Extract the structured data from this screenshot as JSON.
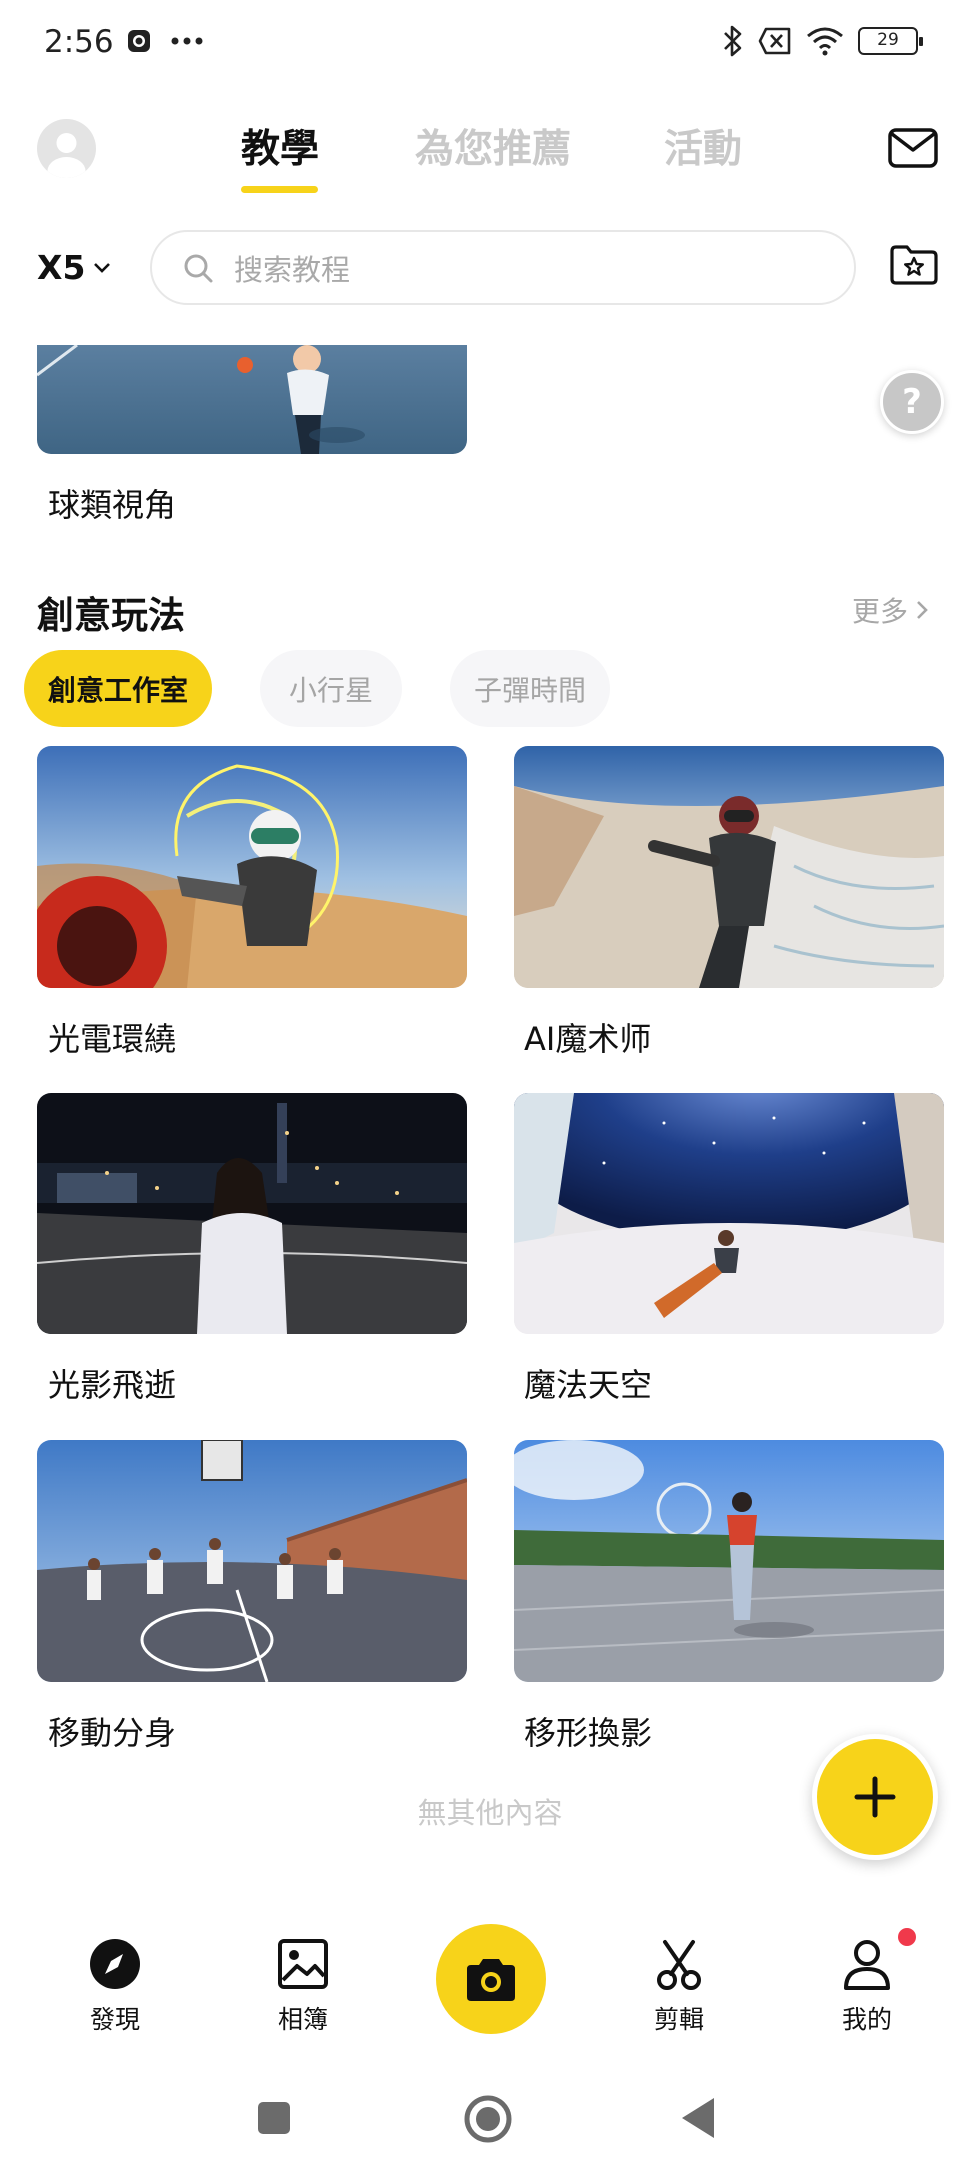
{
  "status_bar": {
    "time": "2:56",
    "battery": "29"
  },
  "header": {
    "tabs": [
      {
        "label": "教學",
        "active": true
      },
      {
        "label": "為您推薦",
        "active": false
      },
      {
        "label": "活動",
        "active": false
      }
    ]
  },
  "search": {
    "model": "X5",
    "placeholder": "搜索教程"
  },
  "top_card": {
    "title": "球類視角"
  },
  "section": {
    "title": "創意玩法",
    "more_label": "更多",
    "chips": [
      {
        "label": "創意工作室",
        "active": true
      },
      {
        "label": "小行星",
        "active": false
      },
      {
        "label": "子彈時間",
        "active": false
      }
    ],
    "cards": [
      {
        "title": "光電環繞"
      },
      {
        "title": "AI魔术师"
      },
      {
        "title": "光影飛逝"
      },
      {
        "title": "魔法天空"
      },
      {
        "title": "移動分身"
      },
      {
        "title": "移形換影"
      }
    ],
    "end_text": "無其他內容"
  },
  "bottom_nav": {
    "items": [
      {
        "label": "發現",
        "icon": "compass-icon"
      },
      {
        "label": "相簿",
        "icon": "image-icon"
      },
      {
        "label": "",
        "icon": "camera-icon"
      },
      {
        "label": "剪輯",
        "icon": "scissors-icon"
      },
      {
        "label": "我的",
        "icon": "person-icon"
      }
    ]
  },
  "colors": {
    "accent": "#f7d31a",
    "notification": "#f0394b",
    "muted_text": "#c9c9c9"
  }
}
